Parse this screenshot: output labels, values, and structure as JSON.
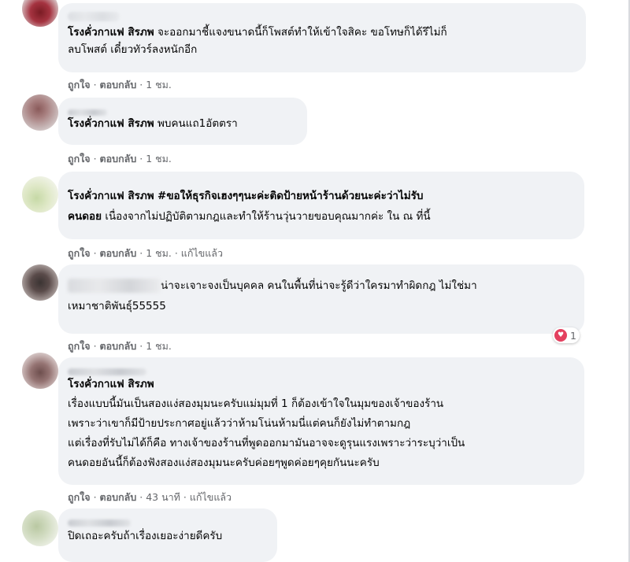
{
  "comments": [
    {
      "tag": "โรงคั่วกาแฟ สิรภพ",
      "lines": [
        "จะออกมาชี้แจงขนาดนี้ก็โพสต์ทำให้เข้าใจสิคะ ขอโทษก็ได้รึไม่ก็",
        "ลบโพสต์ เดี๋ยวทัวร์ลงหนักอีก"
      ],
      "like": "ถูกใจ",
      "reply": "ตอบกลับ",
      "time": "1 ชม.",
      "edited": ""
    },
    {
      "tag": "โรงคั่วกาแฟ สิรภพ",
      "lines": [
        "พบคนแถ1อัตตรา"
      ],
      "like": "ถูกใจ",
      "reply": "ตอบกลับ",
      "time": "1 ชม.",
      "edited": ""
    },
    {
      "tag": "โรงคั่วกาแฟ สิรภพ",
      "hashtag": "#ขอให้ธุรกิจเฮงๆๆนะค่ะติดป้ายหน้าร้านด้วยนะค่ะว่าไม่รับ",
      "hashtag2": "คนดอย",
      "lines": [
        "เนื่องจากไม่ปฏิบัติตามกฎและทำให้ร้านวุ่นวายขอบคุณมากค่ะ ใน ณ ที่นี้"
      ],
      "like": "ถูกใจ",
      "reply": "ตอบกลับ",
      "time": "1 ชม.",
      "edited": "แก้ไขแล้ว"
    },
    {
      "lines": [
        "น่าจะเจาะจงเป็นบุคคล คนในพื้นที่น่าจะรู้ดีว่าใครมาทำผิดกฎ ไม่ใช่มา",
        "เหมาชาติพันธุ์55555"
      ],
      "like": "ถูกใจ",
      "reply": "ตอบกลับ",
      "time": "1 ชม.",
      "edited": "",
      "reaction_count": "1"
    },
    {
      "tag": "โรงคั่วกาแฟ สิรภพ",
      "lines": [
        "เรื่องแบบนี้มันเป็นสองแง่สองมุมนะครับแม่มุมที่ 1 ก็ต้องเข้าใจในมุมของเจ้าของร้าน",
        "เพราะว่าเขาก็มีป้ายประกาศอยู่แล้วว่าห้ามโน่นห้ามนี่แต่คนก็ยังไม่ทำตามกฎ",
        "แต่เรื่องที่รับไม่ได้ก็คือ ทางเจ้าของร้านที่พูดออกมามันอาจจะดูรุนแรงเพราะว่าระบุว่าเป็น",
        "คนดอยอันนี้ก็ต้องฟังสองแง่สองมุมนะครับค่อยๆพูดค่อยๆคุยกันนะครับ"
      ],
      "like": "ถูกใจ",
      "reply": "ตอบกลับ",
      "time": "43 นาที",
      "edited": "แก้ไขแล้ว"
    },
    {
      "lines": [
        "ปิดเถอะครับถ้าเรื่องเยอะง่ายดีครับ"
      ]
    }
  ],
  "separator": "·",
  "colors": {
    "bubble": "#f0f2f5",
    "meta": "#65676b",
    "reaction": "#e4405f"
  }
}
